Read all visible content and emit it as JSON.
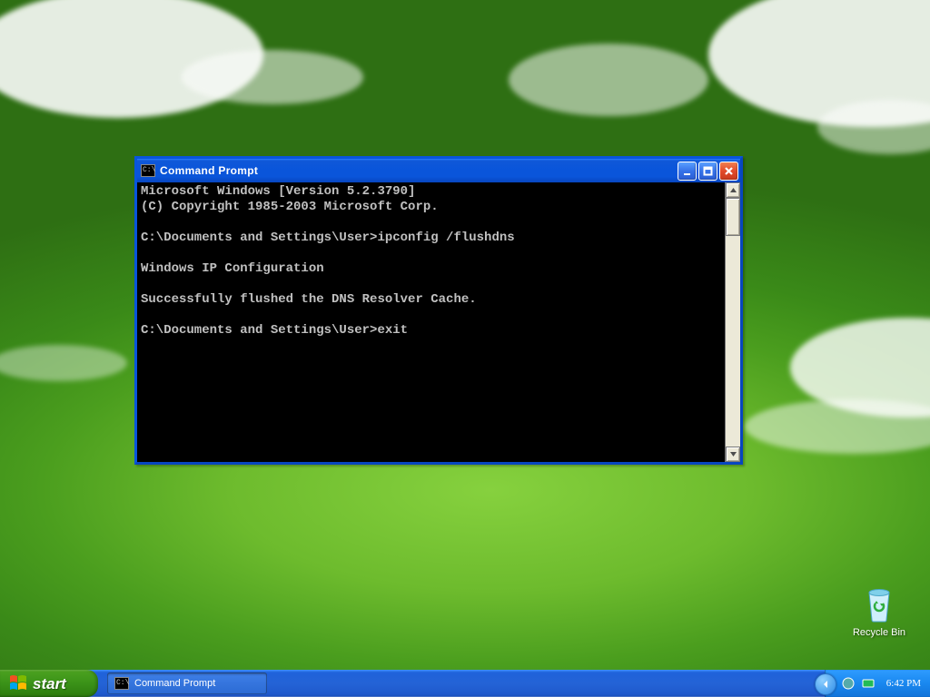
{
  "window": {
    "title": "Command Prompt",
    "icon_text": "C:\\",
    "terminal_lines": [
      "Microsoft Windows [Version 5.2.3790]",
      "(C) Copyright 1985-2003 Microsoft Corp.",
      "",
      "C:\\Documents and Settings\\User>ipconfig /flushdns",
      "",
      "Windows IP Configuration",
      "",
      "Successfully flushed the DNS Resolver Cache.",
      "",
      "C:\\Documents and Settings\\User>exit"
    ]
  },
  "desktop": {
    "recycle_bin_label": "Recycle Bin"
  },
  "taskbar": {
    "start_label": "start",
    "task_button_label": "Command Prompt",
    "task_button_icon_text": "C:\\",
    "clock": "6:42 PM"
  }
}
